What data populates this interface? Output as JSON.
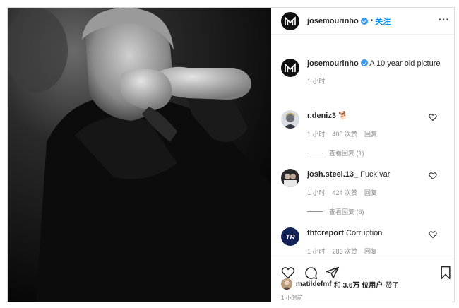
{
  "post": {
    "username": "josemourinho",
    "follow_label": "关注",
    "more_label": "···",
    "caption": "A 10 year old picture",
    "caption_time": "1 小时"
  },
  "comments": [
    {
      "username": "r.deniz3",
      "text": "🐕",
      "time": "1 小时",
      "likes": "408 次赞",
      "reply": "回复",
      "view_replies": "查看回复 (1)"
    },
    {
      "username": "josh.steel.13_",
      "text": "Fuck var",
      "time": "1 小时",
      "likes": "424 次赞",
      "reply": "回复",
      "view_replies": "查看回复 (6)"
    },
    {
      "username": "thfcreport",
      "text": "Corruption",
      "time": "1 小时",
      "likes": "283 次赞",
      "reply": "回复"
    }
  ],
  "likes_line": {
    "user": "matildefmf",
    "connector": "和",
    "count": "3.6万 位用户",
    "suffix": "赞了"
  },
  "posted_time": "1 小时前",
  "icons": [
    "heart-icon",
    "comment-icon",
    "share-icon",
    "bookmark-icon",
    "verified-badge-icon"
  ],
  "colors": {
    "link": "#0095f6",
    "verified": "#3897f0",
    "muted": "#8e8e8e"
  }
}
